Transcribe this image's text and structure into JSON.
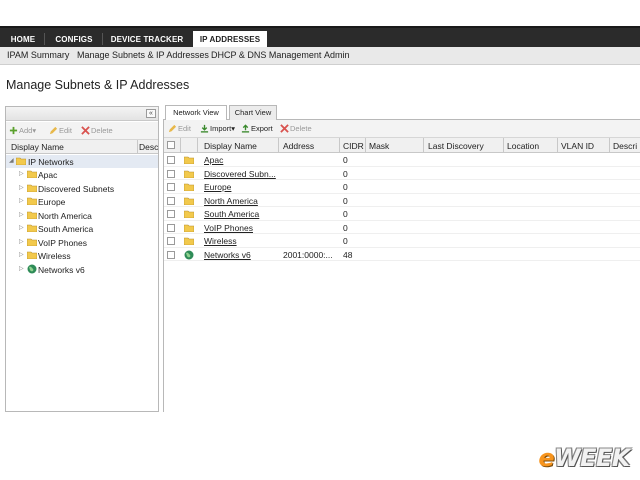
{
  "top_nav": {
    "tabs": [
      {
        "label": "HOME",
        "active": false
      },
      {
        "label": "CONFIGS",
        "active": false
      },
      {
        "label": "DEVICE TRACKER",
        "active": false
      },
      {
        "label": "IP ADDRESSES",
        "active": true
      }
    ]
  },
  "sub_nav": {
    "items": [
      "IPAM Summary",
      "Manage Subnets & IP Addresses",
      "DHCP & DNS Management",
      "Admin"
    ]
  },
  "page": {
    "title": "Manage Subnets & IP Addresses"
  },
  "left_panel": {
    "collapse_glyph": "«",
    "toolbar": {
      "add": "Add",
      "edit": "Edit",
      "delete": "Delete"
    },
    "columns": [
      "Display Name",
      "Desc"
    ],
    "tree": {
      "root": "IP Networks",
      "children": [
        {
          "label": "Apac",
          "icon": "folder-icon"
        },
        {
          "label": "Discovered Subnets",
          "icon": "folder-icon"
        },
        {
          "label": "Europe",
          "icon": "folder-icon"
        },
        {
          "label": "North America",
          "icon": "folder-icon"
        },
        {
          "label": "South America",
          "icon": "folder-icon"
        },
        {
          "label": "VoIP Phones",
          "icon": "folder-icon"
        },
        {
          "label": "Wireless",
          "icon": "folder-icon"
        },
        {
          "label": "Networks v6",
          "icon": "globe-icon"
        }
      ]
    }
  },
  "right_panel": {
    "view_tabs": [
      {
        "label": "Network View",
        "active": true
      },
      {
        "label": "Chart View",
        "active": false
      }
    ],
    "toolbar": {
      "edit": "Edit",
      "import": "Import",
      "export": "Export",
      "delete": "Delete"
    },
    "columns": [
      "Display Name",
      "Address",
      "CIDR",
      "Mask",
      "Last Discovery",
      "Location",
      "VLAN ID",
      "Descri"
    ],
    "rows": [
      {
        "name": "Apac",
        "address": "",
        "cidr": "0",
        "icon": "folder-icon"
      },
      {
        "name": "Discovered Subn...",
        "address": "",
        "cidr": "0",
        "icon": "folder-icon"
      },
      {
        "name": "Europe",
        "address": "",
        "cidr": "0",
        "icon": "folder-icon"
      },
      {
        "name": "North America",
        "address": "",
        "cidr": "0",
        "icon": "folder-icon"
      },
      {
        "name": "South America",
        "address": "",
        "cidr": "0",
        "icon": "folder-icon"
      },
      {
        "name": "VoIP Phones",
        "address": "",
        "cidr": "0",
        "icon": "folder-icon"
      },
      {
        "name": "Wireless",
        "address": "",
        "cidr": "0",
        "icon": "folder-icon"
      },
      {
        "name": "Networks v6",
        "address": "2001:0000:...",
        "cidr": "48",
        "icon": "globe-icon"
      }
    ]
  },
  "brand": {
    "logo_e": "e",
    "logo_rest": "WEEK"
  },
  "colors": {
    "top_nav_bg": "#2b2b2b",
    "folder": "#f2c94c",
    "globe": "#2e8b57",
    "brand_orange": "#f7941d"
  }
}
